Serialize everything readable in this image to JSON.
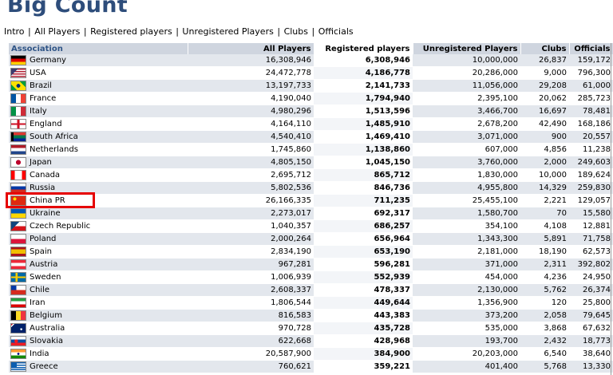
{
  "page": {
    "title": "Big Count"
  },
  "nav": {
    "items": [
      "Intro",
      "All Players",
      "Registered players",
      "Unregistered Players",
      "Clubs",
      "Officials"
    ]
  },
  "table": {
    "headers": {
      "association": "Association",
      "all_players": "All Players",
      "registered": "Registered players",
      "unregistered": "Unregistered Players",
      "clubs": "Clubs",
      "officials": "Officials"
    },
    "highlighted_row": "China PR",
    "highlight_color": "#e60000",
    "rows": [
      {
        "name": "Germany",
        "flag": "germany-flag-icon",
        "all": "16,308,946",
        "reg": "6,308,946",
        "unreg": "10,000,000",
        "clubs": "26,837",
        "off": "159,172"
      },
      {
        "name": "USA",
        "flag": "usa-flag-icon",
        "all": "24,472,778",
        "reg": "4,186,778",
        "unreg": "20,286,000",
        "clubs": "9,000",
        "off": "796,300"
      },
      {
        "name": "Brazil",
        "flag": "brazil-flag-icon",
        "all": "13,197,733",
        "reg": "2,141,733",
        "unreg": "11,056,000",
        "clubs": "29,208",
        "off": "61,000"
      },
      {
        "name": "France",
        "flag": "france-flag-icon",
        "all": "4,190,040",
        "reg": "1,794,940",
        "unreg": "2,395,100",
        "clubs": "20,062",
        "off": "285,723"
      },
      {
        "name": "Italy",
        "flag": "italy-flag-icon",
        "all": "4,980,296",
        "reg": "1,513,596",
        "unreg": "3,466,700",
        "clubs": "16,697",
        "off": "78,481"
      },
      {
        "name": "England",
        "flag": "england-flag-icon",
        "all": "4,164,110",
        "reg": "1,485,910",
        "unreg": "2,678,200",
        "clubs": "42,490",
        "off": "168,186"
      },
      {
        "name": "South Africa",
        "flag": "south-africa-flag-icon",
        "all": "4,540,410",
        "reg": "1,469,410",
        "unreg": "3,071,000",
        "clubs": "900",
        "off": "20,557"
      },
      {
        "name": "Netherlands",
        "flag": "netherlands-flag-icon",
        "all": "1,745,860",
        "reg": "1,138,860",
        "unreg": "607,000",
        "clubs": "4,856",
        "off": "11,238"
      },
      {
        "name": "Japan",
        "flag": "japan-flag-icon",
        "all": "4,805,150",
        "reg": "1,045,150",
        "unreg": "3,760,000",
        "clubs": "2,000",
        "off": "249,603"
      },
      {
        "name": "Canada",
        "flag": "canada-flag-icon",
        "all": "2,695,712",
        "reg": "865,712",
        "unreg": "1,830,000",
        "clubs": "10,000",
        "off": "189,624"
      },
      {
        "name": "Russia",
        "flag": "russia-flag-icon",
        "all": "5,802,536",
        "reg": "846,736",
        "unreg": "4,955,800",
        "clubs": "14,329",
        "off": "259,830"
      },
      {
        "name": "China PR",
        "flag": "china-flag-icon",
        "all": "26,166,335",
        "reg": "711,235",
        "unreg": "25,455,100",
        "clubs": "2,221",
        "off": "129,057"
      },
      {
        "name": "Ukraine",
        "flag": "ukraine-flag-icon",
        "all": "2,273,017",
        "reg": "692,317",
        "unreg": "1,580,700",
        "clubs": "70",
        "off": "15,580"
      },
      {
        "name": "Czech Republic",
        "flag": "czech-flag-icon",
        "all": "1,040,357",
        "reg": "686,257",
        "unreg": "354,100",
        "clubs": "4,108",
        "off": "12,881"
      },
      {
        "name": "Poland",
        "flag": "poland-flag-icon",
        "all": "2,000,264",
        "reg": "656,964",
        "unreg": "1,343,300",
        "clubs": "5,891",
        "off": "71,758"
      },
      {
        "name": "Spain",
        "flag": "spain-flag-icon",
        "all": "2,834,190",
        "reg": "653,190",
        "unreg": "2,181,000",
        "clubs": "18,190",
        "off": "62,573"
      },
      {
        "name": "Austria",
        "flag": "austria-flag-icon",
        "all": "967,281",
        "reg": "596,281",
        "unreg": "371,000",
        "clubs": "2,311",
        "off": "392,802"
      },
      {
        "name": "Sweden",
        "flag": "sweden-flag-icon",
        "all": "1,006,939",
        "reg": "552,939",
        "unreg": "454,000",
        "clubs": "4,236",
        "off": "24,950"
      },
      {
        "name": "Chile",
        "flag": "chile-flag-icon",
        "all": "2,608,337",
        "reg": "478,337",
        "unreg": "2,130,000",
        "clubs": "5,762",
        "off": "26,374"
      },
      {
        "name": "Iran",
        "flag": "iran-flag-icon",
        "all": "1,806,544",
        "reg": "449,644",
        "unreg": "1,356,900",
        "clubs": "120",
        "off": "25,800"
      },
      {
        "name": "Belgium",
        "flag": "belgium-flag-icon",
        "all": "816,583",
        "reg": "443,383",
        "unreg": "373,200",
        "clubs": "2,058",
        "off": "79,645"
      },
      {
        "name": "Australia",
        "flag": "australia-flag-icon",
        "all": "970,728",
        "reg": "435,728",
        "unreg": "535,000",
        "clubs": "3,868",
        "off": "67,632"
      },
      {
        "name": "Slovakia",
        "flag": "slovakia-flag-icon",
        "all": "622,668",
        "reg": "428,968",
        "unreg": "193,700",
        "clubs": "2,432",
        "off": "18,773"
      },
      {
        "name": "India",
        "flag": "india-flag-icon",
        "all": "20,587,900",
        "reg": "384,900",
        "unreg": "20,203,000",
        "clubs": "6,540",
        "off": "38,640"
      },
      {
        "name": "Greece",
        "flag": "greece-flag-icon",
        "all": "760,621",
        "reg": "359,221",
        "unreg": "401,400",
        "clubs": "5,768",
        "off": "13,330"
      }
    ]
  }
}
